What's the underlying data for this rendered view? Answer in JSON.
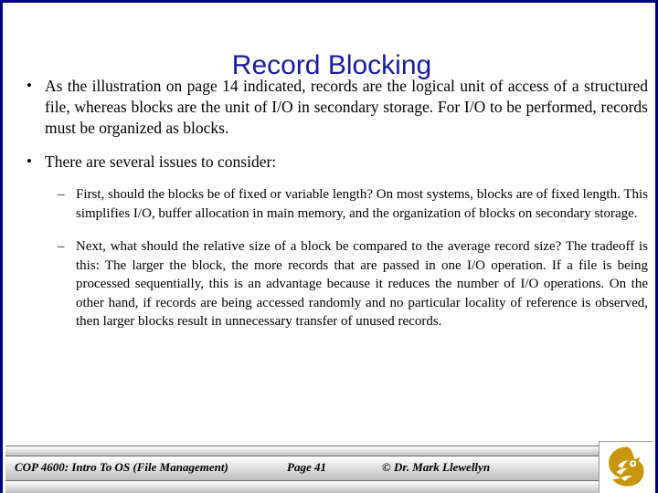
{
  "slide": {
    "title": "Record Blocking",
    "title_color": "#1a1aa0",
    "border_color": "#000080",
    "background": "#ffffff"
  },
  "bullets": [
    {
      "level": 1,
      "marker": "•",
      "text": "As the illustration on page 14 indicated, records are the logical unit of access of a structured file, whereas blocks are the unit of I/O in secondary storage.  For I/O to be performed, records must be organized as blocks."
    },
    {
      "level": 1,
      "marker": "•",
      "text": "There are several issues to consider:"
    },
    {
      "level": 2,
      "marker": "–",
      "text": "First, should the blocks be of fixed or variable length?  On most systems, blocks are of fixed length.  This simplifies I/O, buffer allocation in main memory, and the organization of blocks on secondary storage."
    },
    {
      "level": 2,
      "marker": "–",
      "text": "Next, what should the relative size of a block be compared to the average record size?  The tradeoff is this:  The larger the block, the more records that are passed in one I/O operation.  If a file is being processed sequentially, this is an advantage because it reduces the number of I/O operations.  On the other hand, if records are being accessed randomly and no particular locality of reference is observed, then larger blocks result in unnecessary transfer of unused records."
    }
  ],
  "footer": {
    "course": "COP 4600: Intro To OS  (File Management)",
    "page": "Page 41",
    "author": "© Dr. Mark Llewellyn",
    "logo_name": "ucf-pegasus-logo",
    "logo_color": "#c8960a"
  }
}
